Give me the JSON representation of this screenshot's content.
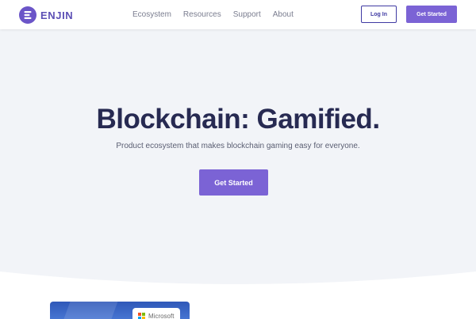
{
  "brand": {
    "name": "ENJIN",
    "color": "#5c4fb5"
  },
  "nav": {
    "links": [
      "Ecosystem",
      "Resources",
      "Support",
      "About"
    ],
    "login_label": "Log In",
    "cta_label": "Get Started"
  },
  "hero": {
    "title": "Blockchain: Gamified.",
    "subtitle": "Product ecosystem that makes blockchain gaming easy for everyone.",
    "cta_label": "Get Started",
    "background": "#f2f4f8"
  },
  "preview_card": {
    "badge_text": "Microsoft",
    "badge_icon": "microsoft-logo-icon"
  },
  "colors": {
    "accent": "#7b63d5",
    "heading": "#272a52",
    "login_border": "#3f3aa3"
  }
}
